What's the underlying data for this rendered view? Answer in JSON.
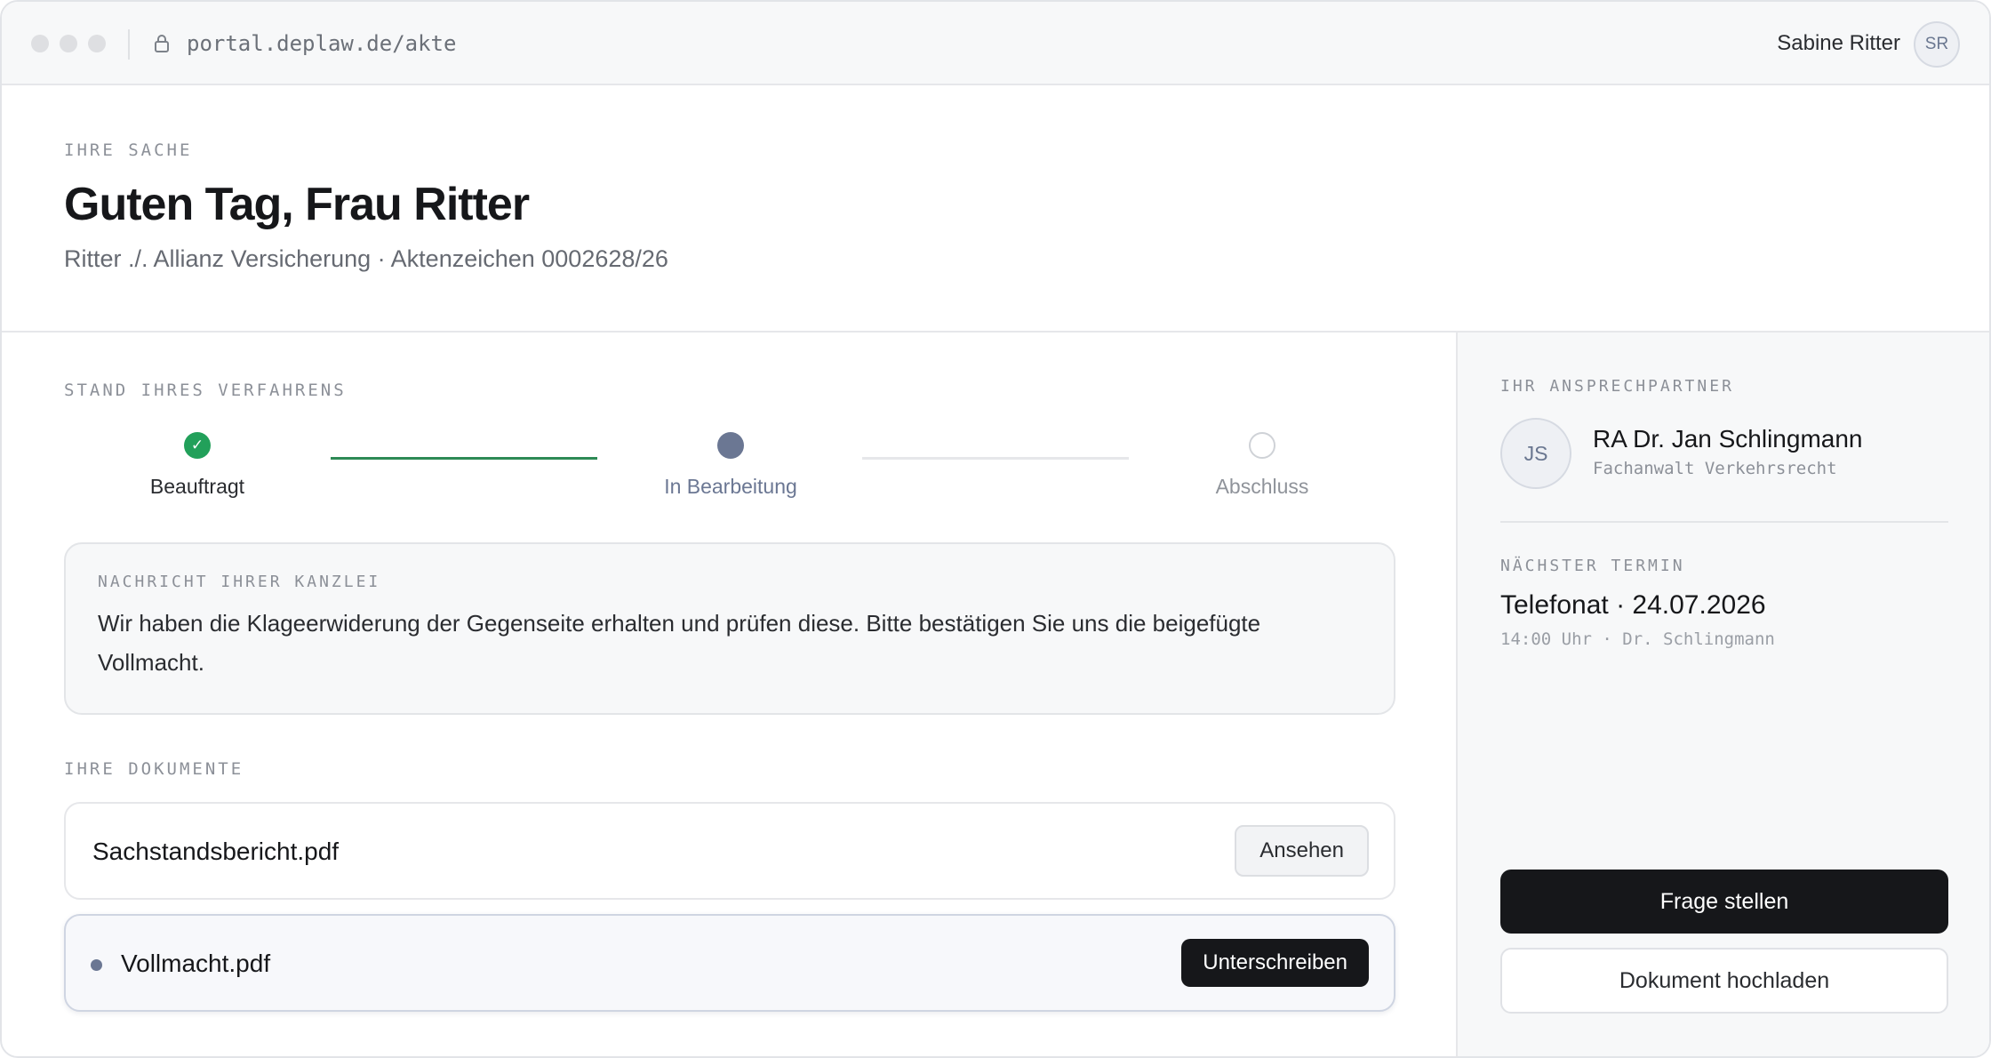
{
  "browser": {
    "url": "portal.deplaw.de/akte",
    "user_name": "Sabine Ritter",
    "user_initials": "SR"
  },
  "header": {
    "eyebrow": "IHRE SACHE",
    "title": "Guten Tag, Frau Ritter",
    "subtitle": "Ritter ./. Allianz Versicherung · Aktenzeichen 0002628/26"
  },
  "progress": {
    "eyebrow": "STAND IHRES VERFAHRENS",
    "steps": [
      {
        "label": "Beauftragt",
        "state": "done"
      },
      {
        "label": "In Bearbeitung",
        "state": "current"
      },
      {
        "label": "Abschluss",
        "state": "pending"
      }
    ],
    "done_mark": "✓"
  },
  "message": {
    "eyebrow": "NACHRICHT IHRER KANZLEI",
    "body": "Wir haben die Klageerwiderung der Gegenseite erhalten und prüfen diese. Bitte bestätigen Sie uns die beigefügte Vollmacht."
  },
  "documents": {
    "eyebrow": "IHRE DOKUMENTE",
    "items": [
      {
        "name": "Sachstandsbericht.pdf",
        "action": "Ansehen"
      },
      {
        "name": "Vollmacht.pdf",
        "action": "Unterschreiben"
      }
    ]
  },
  "sidebar": {
    "contact_eyebrow": "IHR ANSPRECHPARTNER",
    "contact_initials": "JS",
    "contact_name": "RA Dr. Jan Schlingmann",
    "contact_role": "Fachanwalt Verkehrsrecht",
    "appointment_eyebrow": "NÄCHSTER TERMIN",
    "appointment_title": "Telefonat · 24.07.2026",
    "appointment_sub": "14:00 Uhr · Dr. Schlingmann",
    "ask_button": "Frage stellen",
    "upload_button": "Dokument hochladen"
  },
  "colors": {
    "accent_dark": "#16171a",
    "step_done": "#22a05a",
    "step_current": "#6b7793"
  }
}
